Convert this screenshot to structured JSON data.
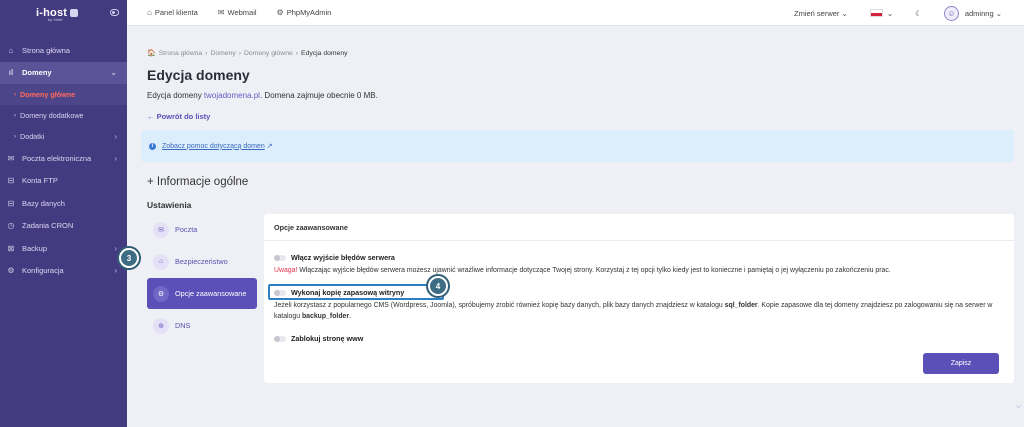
{
  "brand": {
    "name": "i-host",
    "sub": "by Virtel"
  },
  "sidebar": {
    "items": [
      {
        "label": "Strona główna",
        "icon": "⌂"
      },
      {
        "label": "Domeny",
        "icon": "ıl"
      },
      {
        "label": "Domeny główne",
        "icon": "›"
      },
      {
        "label": "Domeny dodatkowe",
        "icon": "›"
      },
      {
        "label": "Dodatki",
        "icon": "›"
      },
      {
        "label": "Poczta elektroniczna",
        "icon": "✉"
      },
      {
        "label": "Konta FTP",
        "icon": "⊟"
      },
      {
        "label": "Bazy danych",
        "icon": "⊟"
      },
      {
        "label": "Zadania CRON",
        "icon": "◷"
      },
      {
        "label": "Backup",
        "icon": "⊠"
      },
      {
        "label": "Konfiguracja",
        "icon": "⚙"
      }
    ]
  },
  "topbar": {
    "links": [
      {
        "label": "Panel klienta",
        "icon": "⌂"
      },
      {
        "label": "Webmail",
        "icon": "✉"
      },
      {
        "label": "PhpMyAdmin",
        "icon": "⚙"
      }
    ],
    "server_label": "Zmień serwer",
    "username": "adminng"
  },
  "breadcrumb": [
    "Strona główna",
    "Domeny",
    "Domeny główne",
    "Edycja domeny"
  ],
  "page": {
    "title": "Edycja domeny",
    "domain_prefix": "Edycja domeny ",
    "domain_name": "twojadomena.pl",
    "domain_suffix": ". Domena zajmuje obecnie 0 MB.",
    "back_label": "← Powrót do listy",
    "help_link": "Zobacz pomoc dotyczącą domen",
    "section_title": "+ Informacje ogólne",
    "settings_title": "Ustawienia"
  },
  "tabs": [
    {
      "label": "Poczta",
      "icon": "✉"
    },
    {
      "label": "Bezpieczeństwo",
      "icon": "🔒"
    },
    {
      "label": "Opcje zaawansowane",
      "icon": "⚙"
    },
    {
      "label": "DNS",
      "icon": "⊕"
    }
  ],
  "panel": {
    "title": "Opcje zaawansowane",
    "opt1_label": "Włącz wyjście błędów serwera",
    "opt1_warn": "Uwaga!",
    "opt1_desc": " Włączając wyjście błędów serwera możesz ujawnić wrażliwe informacje dotyczące Twojej strony. Korzystaj z tej opcji tylko kiedy jest to konieczne i pamiętaj o jej wyłączeniu po zakończeniu prac.",
    "opt2_label": "Wykonaj kopię zapasową witryny",
    "opt2_desc_a": "Jeżeli korzystasz z popularnego CMS (Wordpress, Joomla), spróbujemy zrobić również kopię bazy danych, plik bazy danych znajdziesz w katalogu ",
    "opt2_desc_b": "sql_folder",
    "opt2_desc_c": ". Kopie zapasowe dla tej domeny znajdziesz po zalogowaniu się na serwer w katalogu ",
    "opt2_desc_d": "backup_folder",
    "opt2_desc_e": ".",
    "opt3_label": "Zablokuj stronę www",
    "opt1_enabled": false,
    "opt2_enabled": false,
    "opt3_enabled": false,
    "save_label": "Zapisz"
  },
  "markers": {
    "m3": "3",
    "m4": "4"
  },
  "colors": {
    "accent": "#5b4fb8",
    "sidebar": "#433a80",
    "warning": "#e0354b",
    "info_bg": "#dceefc"
  }
}
